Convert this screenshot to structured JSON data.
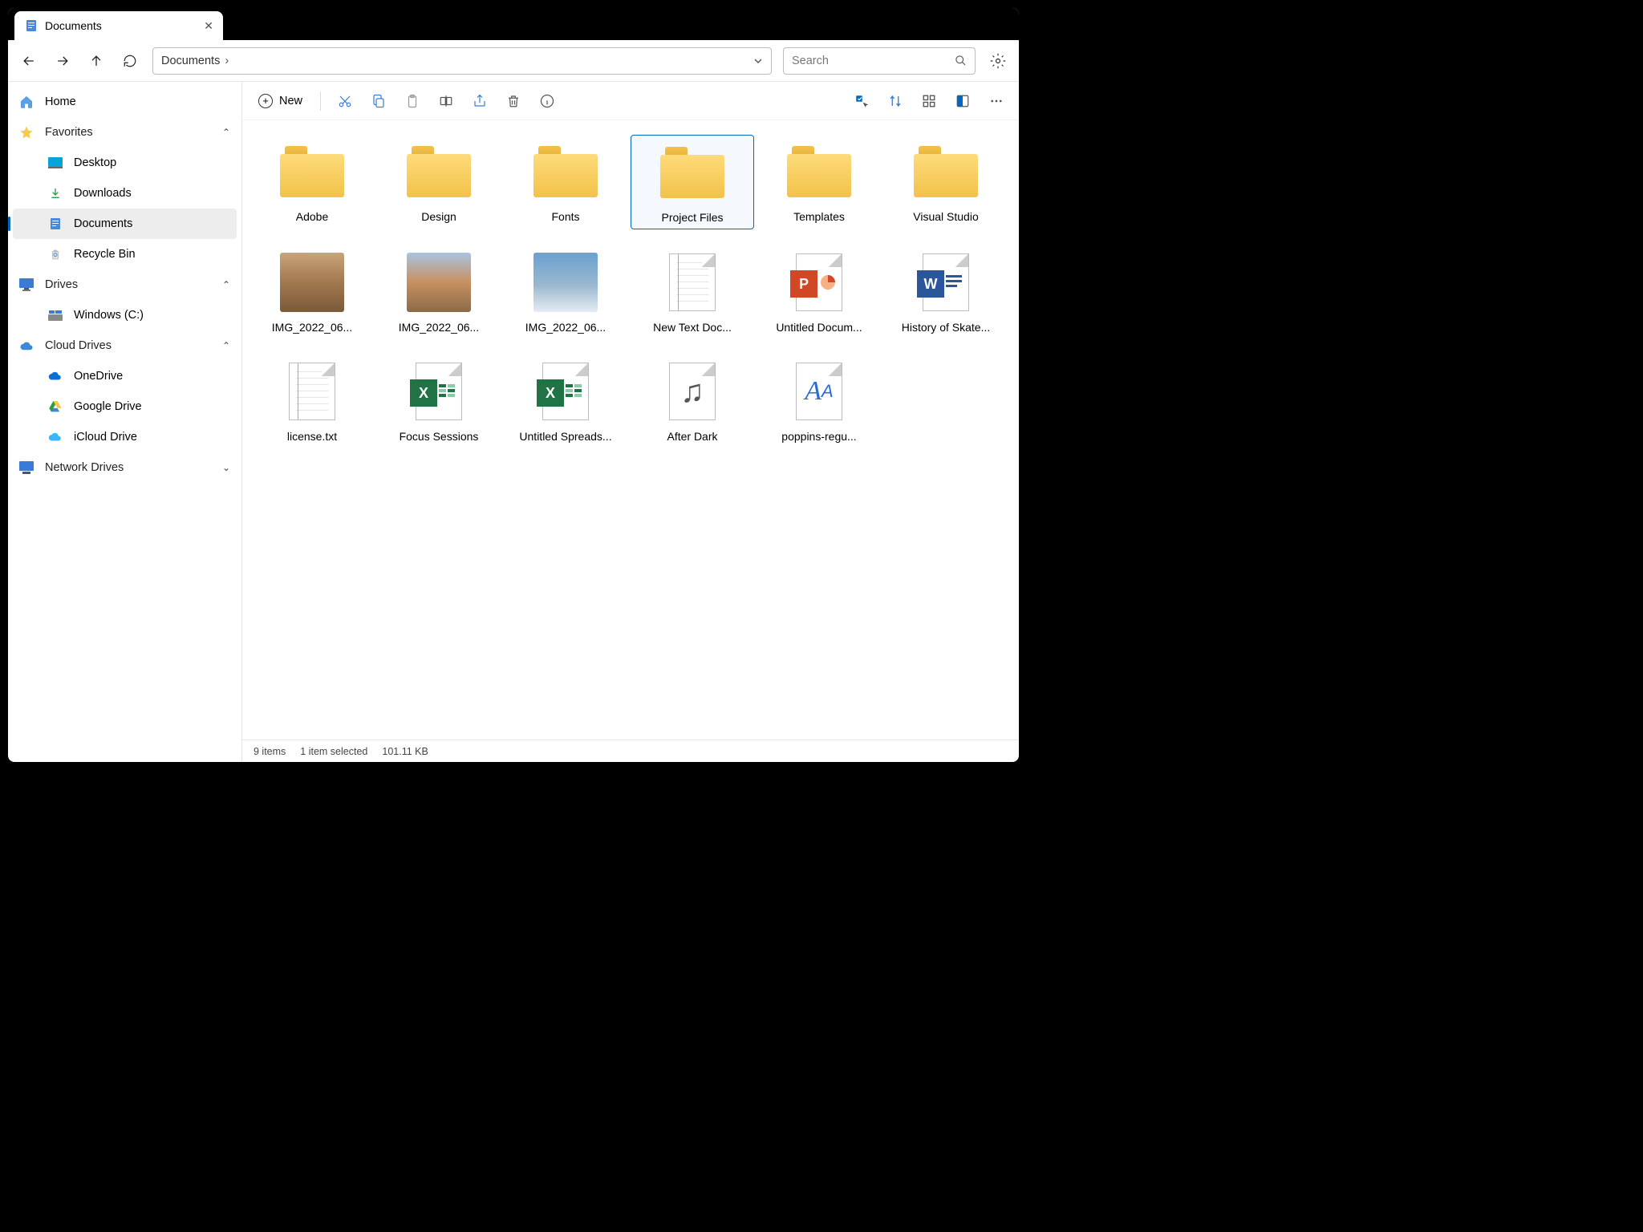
{
  "tab": {
    "title": "Documents"
  },
  "address": {
    "path": "Documents"
  },
  "search": {
    "placeholder": "Search"
  },
  "cmd": {
    "new": "New"
  },
  "sidebar": {
    "home": "Home",
    "favorites": {
      "label": "Favorites",
      "items": [
        "Desktop",
        "Downloads",
        "Documents",
        "Recycle Bin"
      ],
      "selected": 2
    },
    "drives": {
      "label": "Drives",
      "items": [
        "Windows (C:)"
      ]
    },
    "cloud": {
      "label": "Cloud Drives",
      "items": [
        "OneDrive",
        "Google Drive",
        "iCloud Drive"
      ]
    },
    "network": {
      "label": "Network Drives"
    }
  },
  "items": [
    {
      "name": "Adobe",
      "type": "folder"
    },
    {
      "name": "Design",
      "type": "folder"
    },
    {
      "name": "Fonts",
      "type": "folder"
    },
    {
      "name": "Project Files",
      "type": "folder",
      "selected": true
    },
    {
      "name": "Templates",
      "type": "folder"
    },
    {
      "name": "Visual Studio",
      "type": "folder"
    },
    {
      "name": "IMG_2022_06...",
      "type": "image"
    },
    {
      "name": "IMG_2022_06...",
      "type": "image"
    },
    {
      "name": "IMG_2022_06...",
      "type": "image"
    },
    {
      "name": "New Text Doc...",
      "type": "text"
    },
    {
      "name": "Untitled Docum...",
      "type": "ppt"
    },
    {
      "name": "History of Skate...",
      "type": "word"
    },
    {
      "name": "license.txt",
      "type": "text"
    },
    {
      "name": "Focus Sessions",
      "type": "excel"
    },
    {
      "name": "Untitled Spreads...",
      "type": "excel"
    },
    {
      "name": "After Dark",
      "type": "audio"
    },
    {
      "name": "poppins-regu...",
      "type": "font"
    }
  ],
  "status": {
    "count": "9 items",
    "selected": "1 item selected",
    "size": "101.11 KB"
  }
}
